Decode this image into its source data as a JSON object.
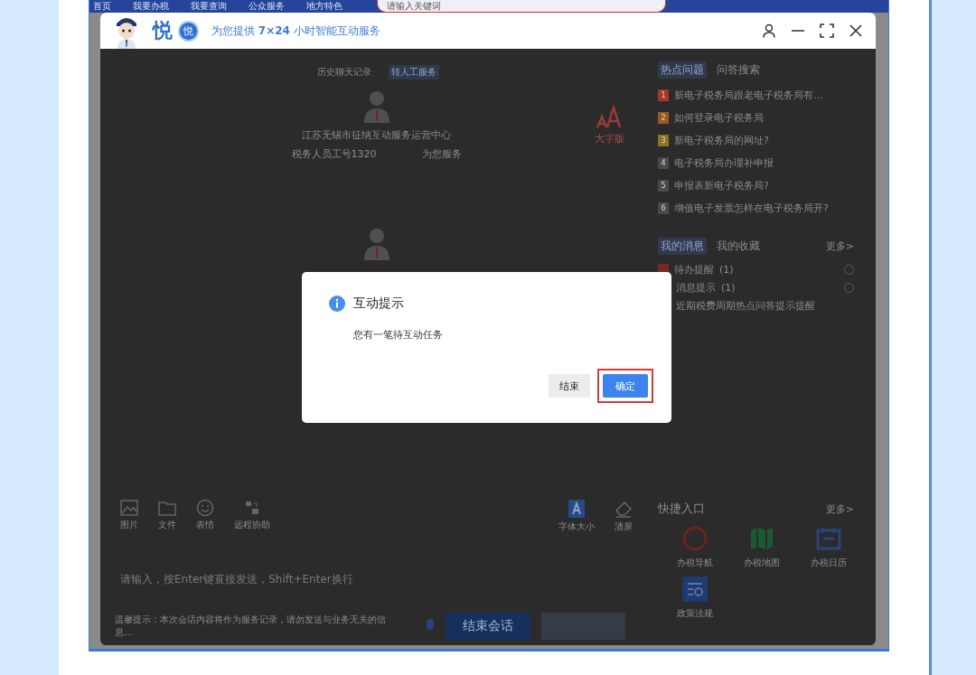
{
  "site_nav": {
    "items": [
      "首页",
      "我要办税",
      "我要查询",
      "公众服务",
      "地方特色"
    ],
    "search": {
      "placeholder": "请输入关键词"
    }
  },
  "chat_window": {
    "logo_text": "悦",
    "logo_badge": "悦",
    "tagline": "为您提供 **7×24** 小时智能互动服务",
    "history_links": [
      {
        "label": "历史聊天记录",
        "selected": false
      },
      {
        "label": "转人工服务",
        "selected": true
      }
    ],
    "agent": {
      "org": "江苏无锡市征纳互动服务运营中心",
      "staff_id": "税务人员工号1320",
      "serving": "为您服务"
    },
    "large_font": "大字版",
    "hot": {
      "tabs": [
        {
          "label": "热点问题",
          "selected": true
        },
        {
          "label": "问答搜索",
          "selected": false
        }
      ],
      "items": [
        {
          "rank": "1",
          "color": "#a8342a",
          "text": "新电子税务局跟老电子税务局有…"
        },
        {
          "rank": "2",
          "color": "#9a5a20",
          "text": "如何登录电子税务局"
        },
        {
          "rank": "3",
          "color": "#8a7420",
          "text": "新电子税务局的网址?"
        },
        {
          "rank": "4",
          "color": "#4a4a4a",
          "text": "电子税务局办理补申报"
        },
        {
          "rank": "5",
          "color": "#4a4a4a",
          "text": "申报表新电子税务局?"
        },
        {
          "rank": "6",
          "color": "#4a4a4a",
          "text": "增值电子发票怎样在电子税务局开?"
        }
      ]
    },
    "messages": {
      "tabs": [
        {
          "label": "我的消息",
          "selected": true
        },
        {
          "label": "我的收藏",
          "selected": false
        }
      ],
      "more": "更多>",
      "items": [
        {
          "text": "待办提醒",
          "count": "(1)",
          "flag": true
        },
        {
          "text": "消息提示",
          "count": "(1)",
          "flag": false
        },
        {
          "text": "近期税费周期热点问答提示提醒",
          "flag": false
        }
      ]
    },
    "toolbar": [
      {
        "label": "图片",
        "kind": "image"
      },
      {
        "label": "文件",
        "kind": "folder"
      },
      {
        "label": "表情",
        "kind": "smile"
      },
      {
        "label": "远程协助",
        "kind": "remote"
      }
    ],
    "right_tools": [
      {
        "label": "字体大小",
        "kind": "font"
      },
      {
        "label": "清屏",
        "kind": "eraser"
      }
    ],
    "input": {
      "placeholder": "请输入，按Enter键直接发送，Shift+Enter换行"
    },
    "footer": {
      "notice": "温馨提示：本次会话内容将作为服务记录，请勿发送与业务无关的信息…",
      "end_button": "结束会话",
      "send_button": {
        "disabled": true
      }
    },
    "shortcuts": {
      "title": "快捷入口",
      "more": "更多>",
      "items": [
        {
          "label": "办税导航",
          "kind": "compass"
        },
        {
          "label": "办税地图",
          "kind": "map"
        },
        {
          "label": "办税日历",
          "kind": "calendar"
        },
        {
          "label": "政策法规",
          "kind": "policy"
        }
      ]
    }
  },
  "dialog": {
    "title": "互动提示",
    "message": "您有一笔待互动任务",
    "buttons": [
      {
        "label": "结束",
        "kind": "secondary",
        "highlighted": false
      },
      {
        "label": "确定",
        "kind": "primary",
        "highlighted": true
      }
    ]
  }
}
